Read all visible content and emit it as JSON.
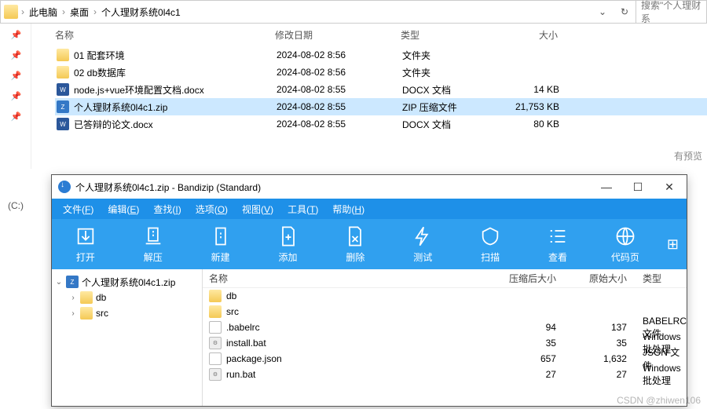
{
  "breadcrumb": {
    "root": "此电脑",
    "p1": "桌面",
    "p2": "个人理财系统0l4c1"
  },
  "search": {
    "placeholder": "搜索\"个人理财系"
  },
  "columns": {
    "name": "名称",
    "date": "修改日期",
    "type": "类型",
    "size": "大小"
  },
  "files": [
    {
      "icon": "folder",
      "name": "01 配套环境",
      "date": "2024-08-02 8:56",
      "type": "文件夹",
      "size": ""
    },
    {
      "icon": "folder",
      "name": "02 db数据库",
      "date": "2024-08-02 8:56",
      "type": "文件夹",
      "size": ""
    },
    {
      "icon": "docx",
      "name": "node.js+vue环境配置文档.docx",
      "date": "2024-08-02 8:55",
      "type": "DOCX 文档",
      "size": "14 KB"
    },
    {
      "icon": "zip",
      "name": "个人理财系统0l4c1.zip",
      "date": "2024-08-02 8:55",
      "type": "ZIP 压缩文件",
      "size": "21,753 KB",
      "selected": true
    },
    {
      "icon": "docx",
      "name": "已答辩的论文.docx",
      "date": "2024-08-02 8:55",
      "type": "DOCX 文档",
      "size": "80 KB"
    }
  ],
  "preview_hint": "有预览",
  "drive_label": "(C:)",
  "bandi": {
    "title": "个人理财系统0l4c1.zip - Bandizip (Standard)",
    "menu": [
      {
        "label": "文件",
        "u": "F"
      },
      {
        "label": "编辑",
        "u": "E"
      },
      {
        "label": "查找",
        "u": "I"
      },
      {
        "label": "选项",
        "u": "O"
      },
      {
        "label": "视图",
        "u": "V"
      },
      {
        "label": "工具",
        "u": "T"
      },
      {
        "label": "帮助",
        "u": "H"
      }
    ],
    "toolbar": [
      {
        "label": "打开",
        "icon": "open"
      },
      {
        "label": "解压",
        "icon": "extract"
      },
      {
        "label": "新建",
        "icon": "new"
      },
      {
        "label": "添加",
        "icon": "add"
      },
      {
        "label": "删除",
        "icon": "delete"
      },
      {
        "label": "测试",
        "icon": "test"
      },
      {
        "label": "扫描",
        "icon": "scan"
      },
      {
        "label": "查看",
        "icon": "view"
      },
      {
        "label": "代码页",
        "icon": "codepage"
      }
    ],
    "tree": {
      "root": "个人理财系统0l4c1.zip",
      "children": [
        {
          "label": "db"
        },
        {
          "label": "src"
        }
      ]
    },
    "cols": {
      "name": "名称",
      "comp": "压缩后大小",
      "orig": "原始大小",
      "type": "类型"
    },
    "rows": [
      {
        "icon": "folder",
        "name": "db",
        "comp": "",
        "orig": "",
        "type": ""
      },
      {
        "icon": "folder",
        "name": "src",
        "comp": "",
        "orig": "",
        "type": ""
      },
      {
        "icon": "generic",
        "name": ".babelrc",
        "comp": "94",
        "orig": "137",
        "type": "BABELRC 文件"
      },
      {
        "icon": "bat",
        "name": "install.bat",
        "comp": "35",
        "orig": "35",
        "type": "Windows 批处理"
      },
      {
        "icon": "generic",
        "name": "package.json",
        "comp": "657",
        "orig": "1,632",
        "type": "JSON 文件"
      },
      {
        "icon": "bat",
        "name": "run.bat",
        "comp": "27",
        "orig": "27",
        "type": "Windows 批处理"
      }
    ]
  },
  "watermark": "CSDN @zhiwen106"
}
